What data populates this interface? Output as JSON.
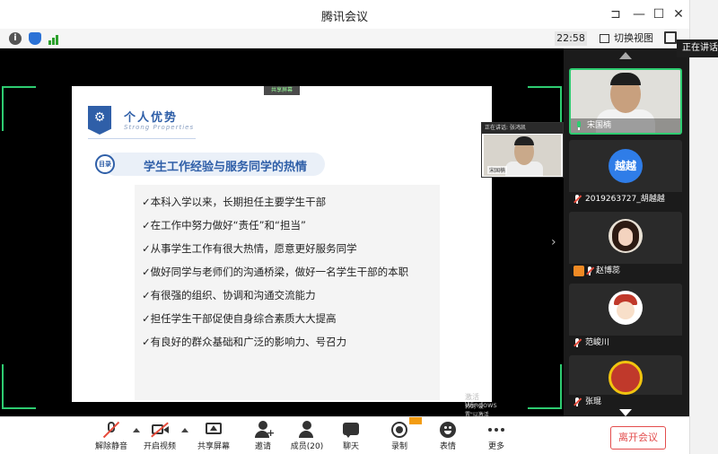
{
  "window": {
    "title": "腾讯会议",
    "side_tab": "正在讲话"
  },
  "infobar": {
    "time": "22:58",
    "switch_view": "切换视图"
  },
  "slide": {
    "share_tag": "共享屏幕",
    "heading": "个人优势",
    "heading_sub": "Strong Properties",
    "section_badge": "目录",
    "section_title": "学生工作经验与服务同学的热情",
    "bullets": [
      "✓本科入学以来，长期担任主要学生干部",
      "✓在工作中努力做好“责任”和“担当”",
      "✓从事学生工作有很大热情，愿意更好服务同学",
      "✓做好同学与老师们的沟通桥梁，做好一名学生干部的本职",
      "✓有很强的组织、协调和沟通交流能力",
      "✓担任学生干部促使自身综合素质大大提高",
      "✓有良好的群众基础和广泛的影响力、号召力"
    ],
    "watermark_line1": "激活 Windows",
    "watermark_line2": "转到\"设置\"以激活 Windows。"
  },
  "pip": {
    "top_text": "正在讲话: 张鸿凯",
    "name": "宋国楠"
  },
  "participants": [
    {
      "name": "宋国楠"
    },
    {
      "name": "2019263727_胡越越",
      "avatar_text": "越越"
    },
    {
      "name": "赵博蕊"
    },
    {
      "name": "范峻川"
    },
    {
      "name": "张琨"
    }
  ],
  "toolbar": {
    "mute": "解除静音",
    "video": "开启视频",
    "share": "共享屏幕",
    "invite": "邀请",
    "members": "成员(20)",
    "chat": "聊天",
    "record": "录制",
    "emoji": "表情",
    "more": "更多",
    "leave": "离开会议"
  },
  "colors": {
    "accent_green": "#2ecc71",
    "leave_red": "#e34d4d",
    "slide_blue": "#2f5fa8"
  }
}
